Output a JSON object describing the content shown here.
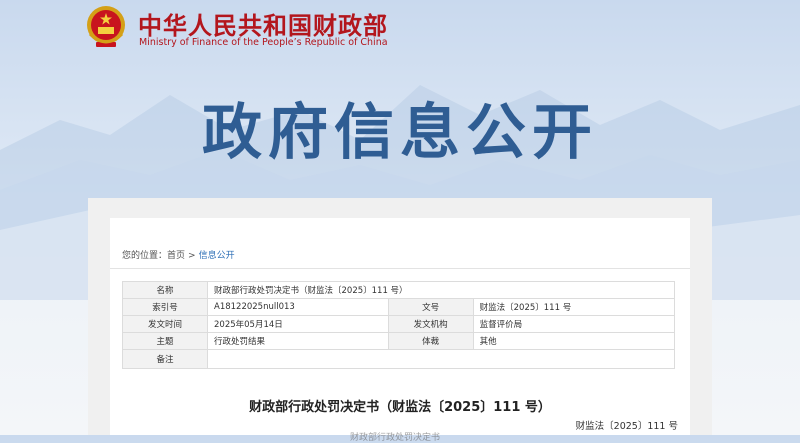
{
  "header": {
    "site_title_cn": "中华人民共和国财政部",
    "site_title_en": "Ministry of Finance of the People’s Republic of China",
    "brand_color": "#b3161d",
    "emblem_icon": "national-emblem-icon"
  },
  "banner": {
    "title": "政府信息公开",
    "title_color": "#2f5d93"
  },
  "breadcrumb": {
    "prefix": "您的位置：",
    "home": "首页",
    "separator": ">",
    "current": "信息公开"
  },
  "info_table": {
    "name_label": "名称",
    "name_value": "财政部行政处罚决定书（财监法〔2025〕111 号）",
    "index_label": "索引号",
    "index_value": "A18122025null013",
    "docnum_label": "文号",
    "docnum_value": "财监法〔2025〕111 号",
    "date_label": "发文时间",
    "date_value": "2025年05月14日",
    "issuer_label": "发文机构",
    "issuer_value": "监督评价局",
    "topic_label": "主题",
    "topic_value": "行政处罚结果",
    "genre_label": "体裁",
    "genre_value": "其他",
    "note_label": "备注",
    "note_value": ""
  },
  "document": {
    "title": "财政部行政处罚决定书（财监法〔2025〕111 号）",
    "number": "财监法〔2025〕111 号",
    "partial_line": "财政部行政处罚决定书"
  }
}
